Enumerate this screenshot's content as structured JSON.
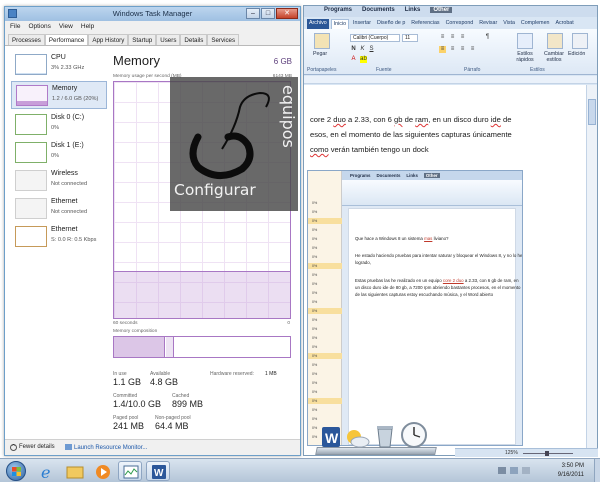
{
  "task_manager": {
    "title": "Windows Task Manager",
    "menu": [
      "File",
      "Options",
      "View",
      "Help"
    ],
    "tabs": [
      "Processes",
      "Performance",
      "App History",
      "Startup",
      "Users",
      "Details",
      "Services"
    ],
    "active_tab": "Performance",
    "resources": [
      {
        "name": "CPU",
        "sub": "3% 2.33 GHz",
        "fill": 0.05
      },
      {
        "name": "Memory",
        "sub": "1.2 / 6.0 GB (20%)",
        "fill": 0.2
      },
      {
        "name": "Disk 0 (C:)",
        "sub": "0%",
        "fill": 0.0
      },
      {
        "name": "Disk 1 (E:)",
        "sub": "0%",
        "fill": 0.0
      },
      {
        "name": "Wireless",
        "sub": "Not connected",
        "fill": 0.0
      },
      {
        "name": "Ethernet",
        "sub": "Not connected",
        "fill": 0.0
      },
      {
        "name": "Ethernet",
        "sub": "S: 0.0 R: 0.5 Kbps",
        "fill": 0.0
      }
    ],
    "memory": {
      "title": "Memory",
      "total": "6 GB",
      "usage_label": "Memory usage per second (MB)",
      "usage_max": "6143 MB",
      "usage_fraction": 0.2,
      "seconds_label": "60 seconds",
      "zero": "0",
      "composition_label": "Memory composition",
      "composition_fraction": 0.29,
      "stats": {
        "in_use_label": "In use",
        "in_use": "1.1 GB",
        "available_label": "Available",
        "available": "4.8 GB",
        "hw_reserved_label": "Hardware reserved:",
        "hw_reserved": "1 MB",
        "committed_label": "Committed",
        "committed": "1.4/10.0 GB",
        "cached_label": "Cached",
        "cached": "899 MB",
        "paged_label": "Paged pool",
        "paged": "241 MB",
        "nonpaged_label": "Non-paged pool",
        "nonpaged": "64.4 MB"
      }
    },
    "footer": {
      "fewer": "Fewer details",
      "resmon": "Launch Resource Monitor..."
    }
  },
  "watermark": {
    "text": "Configurar",
    "vertical": "equipos"
  },
  "word": {
    "menus": [
      "Programs",
      "Documents",
      "Links",
      "Other"
    ],
    "tabs": [
      "Archivo",
      "Inicio",
      "Insertar",
      "Diseño de p",
      "Referencias",
      "Correspond",
      "Revisar",
      "Vista",
      "Complemen",
      "Acrobat"
    ],
    "active_tab": "Inicio",
    "ribbon": {
      "paste": "Pegar",
      "font": "Calibri (Cuerpo)",
      "size": "11",
      "styles": "Estilos rápidos",
      "change_styles": "Cambiar estilos",
      "editing": "Edición",
      "groups": [
        "Portapapeles",
        "Fuente",
        "Párrafo",
        "Estilos"
      ]
    },
    "body": {
      "l1a": "core 2 ",
      "l1b": "duo",
      "l1c": " a 2.33, con 6 ",
      "l1d": "gb",
      "l1e": " de ",
      "l1f": "ram",
      "l1g": ", en un disco duro ",
      "l1h": "ide",
      "l1i": " de",
      "l2": "esos, en el momento de las siguientes capturas únicamente",
      "l3a": "",
      "l3b": "como",
      "l3c": " verán también tengo un dock"
    },
    "zoom": "125%"
  },
  "inner_doc": {
    "menus": [
      "Programs",
      "Documents",
      "Links",
      "Other"
    ],
    "cpu_values": [
      "0%",
      "0%",
      "0%",
      "0%",
      "0%",
      "0%",
      "0%",
      "0%",
      "0%",
      "0%",
      "0%",
      "0%",
      "0%",
      "0%",
      "0%",
      "0%",
      "0%",
      "0%",
      "0%",
      "0%",
      "0%",
      "0%",
      "0%",
      "0%",
      "0%",
      "0%",
      "0%"
    ],
    "p1a": "Que hace a Windows 8 un sistema ",
    "p1b": "mas",
    "p1c": " liviano?",
    "p2": "He estado haciendo pruebas para intentar saturar y bloquear el Windows 8, y no lo he logrado,",
    "p3a": "Estas pruebas las he realizado en un equipo ",
    "p3b": "core 2 duo",
    "p3c": " a 2.33, con 6 gb de ram, en un disco duro ide de 80 gb, a 7200 rpm abriendo bastantes procesos, en el momento de las siguientes capturas estoy escuchando música, y el Word abierto"
  },
  "clock": {
    "time": "3:50 PM",
    "date": "9/16/2011"
  }
}
